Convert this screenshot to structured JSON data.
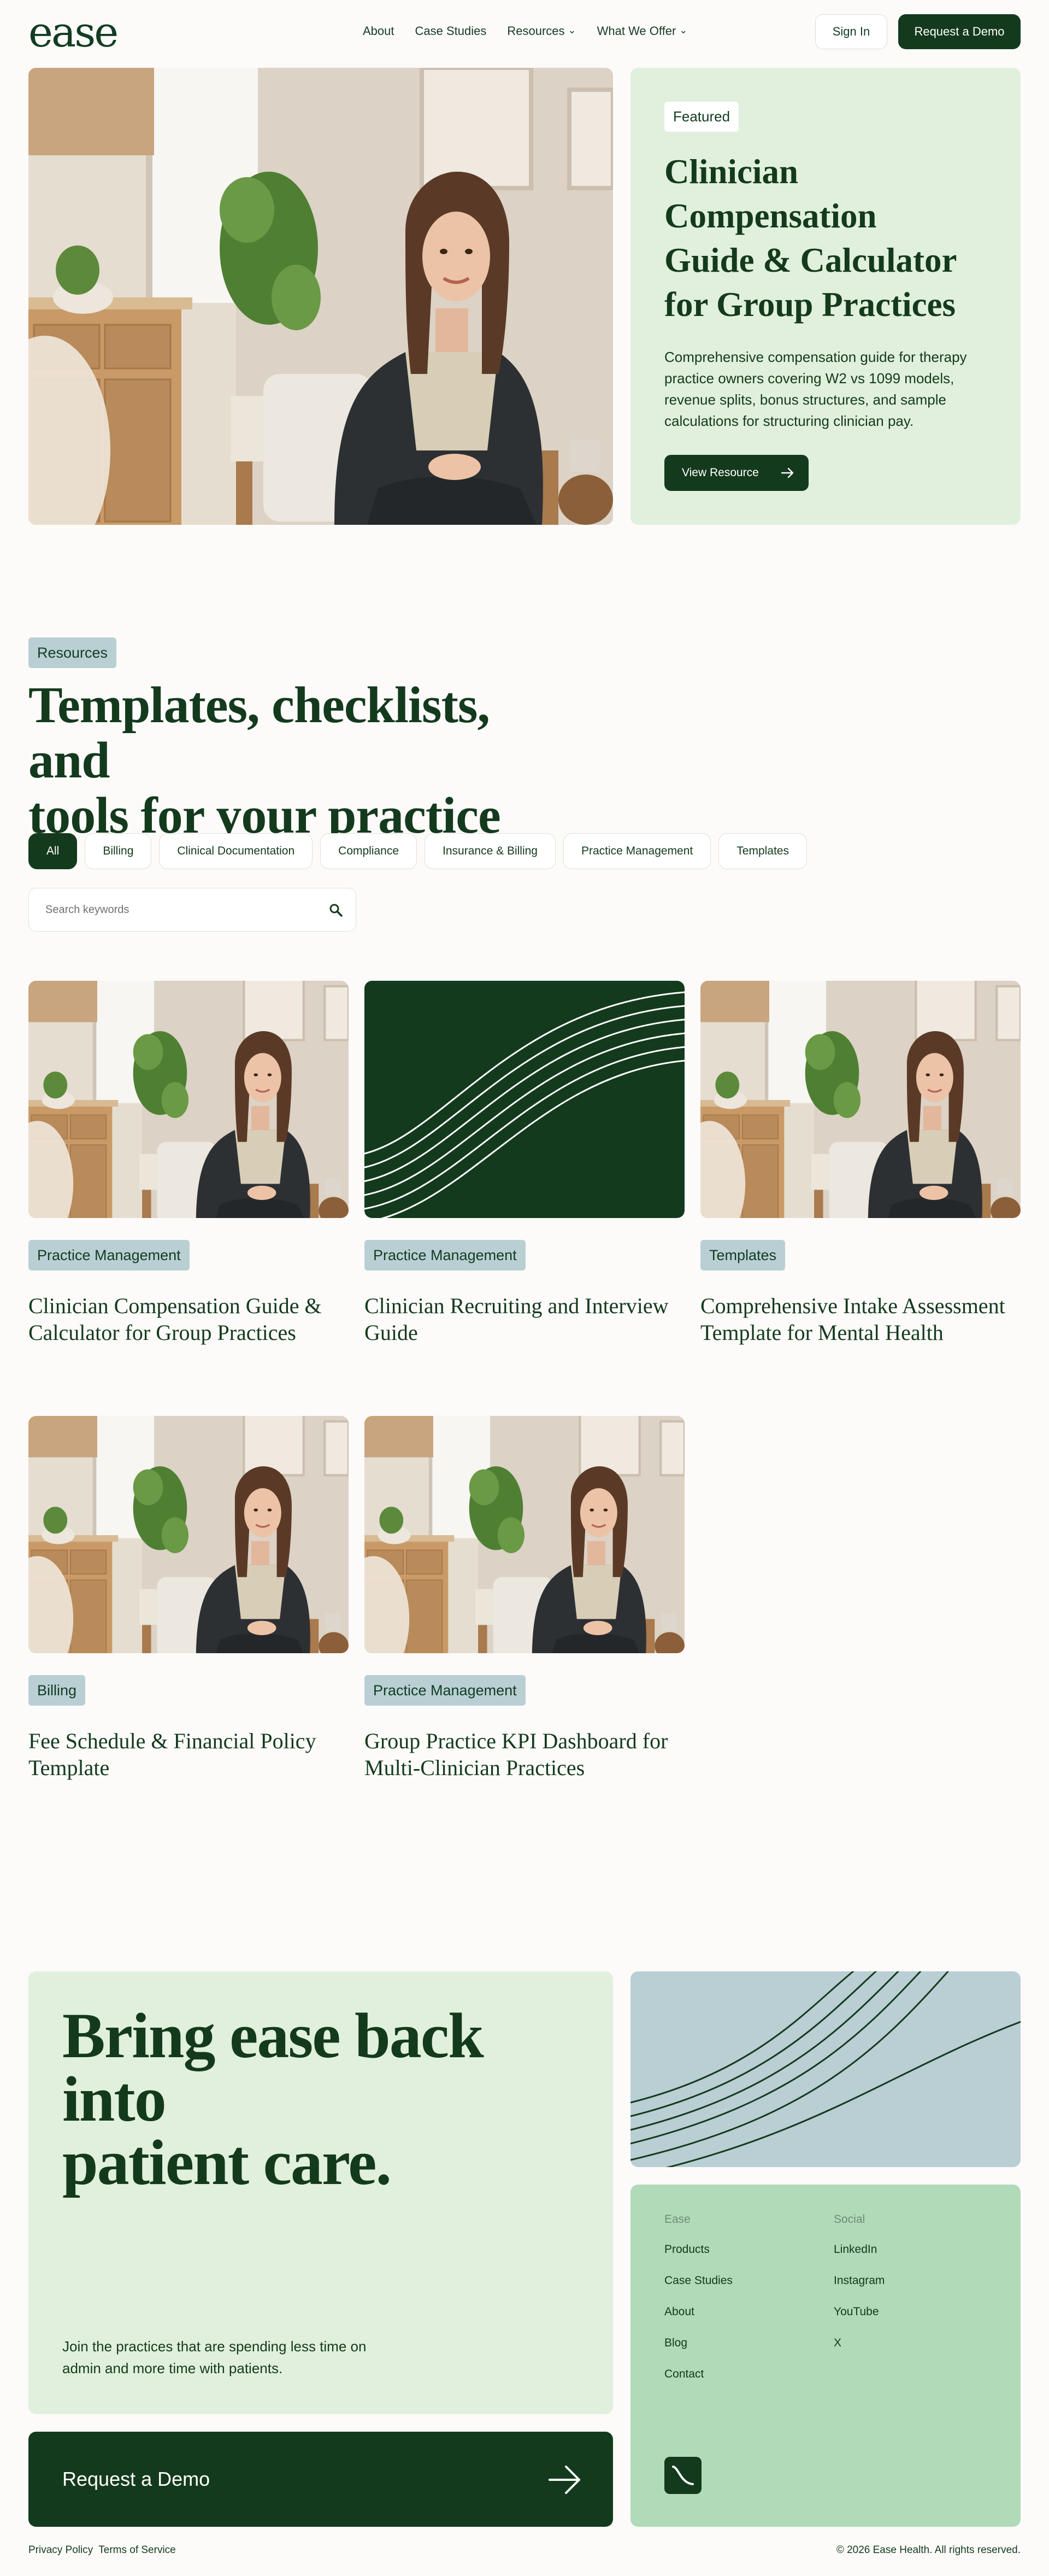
{
  "header": {
    "logo": "ease",
    "nav": [
      {
        "label": "About"
      },
      {
        "label": "Case Studies"
      },
      {
        "label": "Resources",
        "dropdown": true
      },
      {
        "label": "What We Offer",
        "dropdown": true
      }
    ],
    "sign_in": "Sign In",
    "request_demo": "Request a Demo"
  },
  "hero": {
    "badge": "Featured",
    "title": "Clinician Compensation Guide & Calculator for Group Practices",
    "description": "Comprehensive compensation guide for therapy practice owners covering W2 vs 1099 models, revenue splits, bonus structures, and sample calculations for structuring clinician pay.",
    "button": "View Resource"
  },
  "resources": {
    "tag": "Resources",
    "title_line1": "Templates, checklists, and",
    "title_line2": "tools for your practice",
    "filters": [
      "All",
      "Billing",
      "Clinical Documentation",
      "Compliance",
      "Insurance & Billing",
      "Practice Management",
      "Templates"
    ],
    "active_filter": "All",
    "search_placeholder": "Search keywords",
    "cards": [
      {
        "tag": "Practice Management",
        "title": "Clinician Compensation Guide & Calculator for Group Practices",
        "image": "photo"
      },
      {
        "tag": "Practice Management",
        "title": "Clinician Recruiting and Interview Guide",
        "image": "pattern"
      },
      {
        "tag": "Templates",
        "title": "Comprehensive Intake Assessment Template for Mental Health",
        "image": "photo"
      },
      {
        "tag": "Billing",
        "title": "Fee Schedule & Financial Policy Template",
        "image": "photo"
      },
      {
        "tag": "Practice Management",
        "title": "Group Practice KPI Dashboard for Multi-Clinician Practices",
        "image": "photo"
      }
    ]
  },
  "cta": {
    "title_line1": "Bring ease back into",
    "title_line2": "patient care.",
    "subtitle": "Join the practices that are spending less time on admin and more time with patients.",
    "button": "Request a Demo"
  },
  "footer": {
    "col1_heading": "Ease",
    "col1_links": [
      "Products",
      "Case Studies",
      "About",
      "Blog",
      "Contact"
    ],
    "col2_heading": "Social",
    "col2_links": [
      "LinkedIn",
      "Instagram",
      "YouTube",
      "X"
    ],
    "privacy": "Privacy Policy",
    "terms": "Terms of Service",
    "copyright": "© 2026 Ease Health. All rights reserved."
  },
  "colors": {
    "brand_dark_green": "#143a1d",
    "light_green": "#e0f0dc",
    "mint": "#b0dab8",
    "blue_gray": "#b9cfd4",
    "background": "#fcfbf9"
  }
}
